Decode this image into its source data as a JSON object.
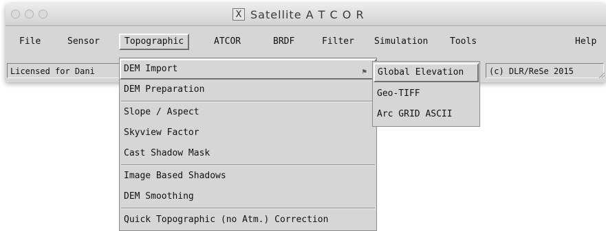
{
  "window": {
    "title": "Satellite A T C O R",
    "title_icon": "x11-icon"
  },
  "menubar": {
    "items": [
      {
        "label": "File"
      },
      {
        "label": "Sensor"
      },
      {
        "label": "Topographic"
      },
      {
        "label": "ATCOR"
      },
      {
        "label": "BRDF"
      },
      {
        "label": "Filter"
      },
      {
        "label": "Simulation"
      },
      {
        "label": "Tools"
      },
      {
        "label": "Help"
      }
    ],
    "active": "Topographic"
  },
  "statusbar": {
    "license_text": "Licensed for Dani",
    "copyright_text": "(c) DLR/ReSe 2015"
  },
  "topographic_menu": {
    "items": [
      {
        "label": "DEM Import",
        "has_submenu": true
      },
      {
        "label": "DEM Preparation"
      },
      {
        "label": "Slope / Aspect"
      },
      {
        "label": "Skyview Factor"
      },
      {
        "label": "Cast Shadow Mask"
      },
      {
        "label": "Image Based Shadows"
      },
      {
        "label": "DEM Smoothing"
      },
      {
        "label": "Quick Topographic (no Atm.) Correction"
      }
    ]
  },
  "dem_import_submenu": {
    "items": [
      {
        "label": "Global Elevation"
      },
      {
        "label": "Geo-TIFF"
      },
      {
        "label": "Arc GRID ASCII"
      }
    ]
  }
}
